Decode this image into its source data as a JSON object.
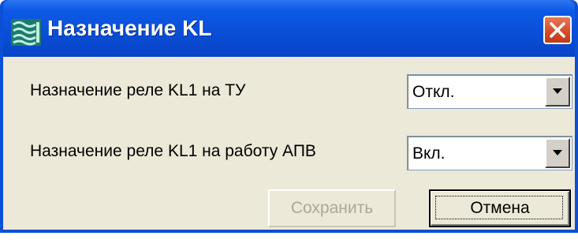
{
  "window": {
    "title": "Назначение KL"
  },
  "fields": [
    {
      "label": "Назначение реле KL1 на ТУ",
      "value": "Откл."
    },
    {
      "label": "Назначение реле KL1 на работу АПВ",
      "value": "Вкл."
    }
  ],
  "buttons": {
    "save_label": "Сохранить",
    "save_enabled": false,
    "cancel_label": "Отмена"
  },
  "icons": {
    "app": "app-icon",
    "close": "close-icon",
    "dropdown": "chevron-down-icon"
  },
  "colors": {
    "titlebar": "#0a4fd7",
    "close_button": "#d8502e",
    "client_background": "#ece9d8",
    "disabled_text": "#aca899"
  }
}
